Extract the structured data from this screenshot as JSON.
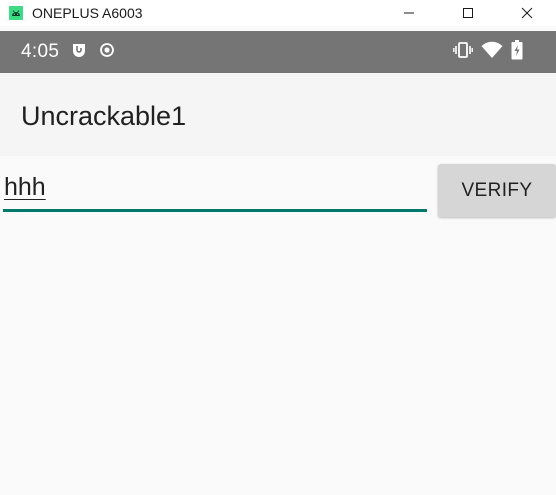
{
  "window": {
    "title": "ONEPLUS A6003",
    "icons": {
      "app": "android-icon",
      "minimize": "minimize-icon",
      "maximize": "maximize-icon",
      "close": "close-icon"
    }
  },
  "status_bar": {
    "time": "4:05",
    "left_icons": [
      "notification-app-icon",
      "record-icon"
    ],
    "right_icons": [
      "vibrate-icon",
      "wifi-icon",
      "battery-charging-icon"
    ],
    "background": "#757575"
  },
  "action_bar": {
    "title": "Uncrackable1",
    "background": "#f5f5f5"
  },
  "form": {
    "input_value": "hhh",
    "verify_label": "VERIFY",
    "accent": "#00796b"
  }
}
